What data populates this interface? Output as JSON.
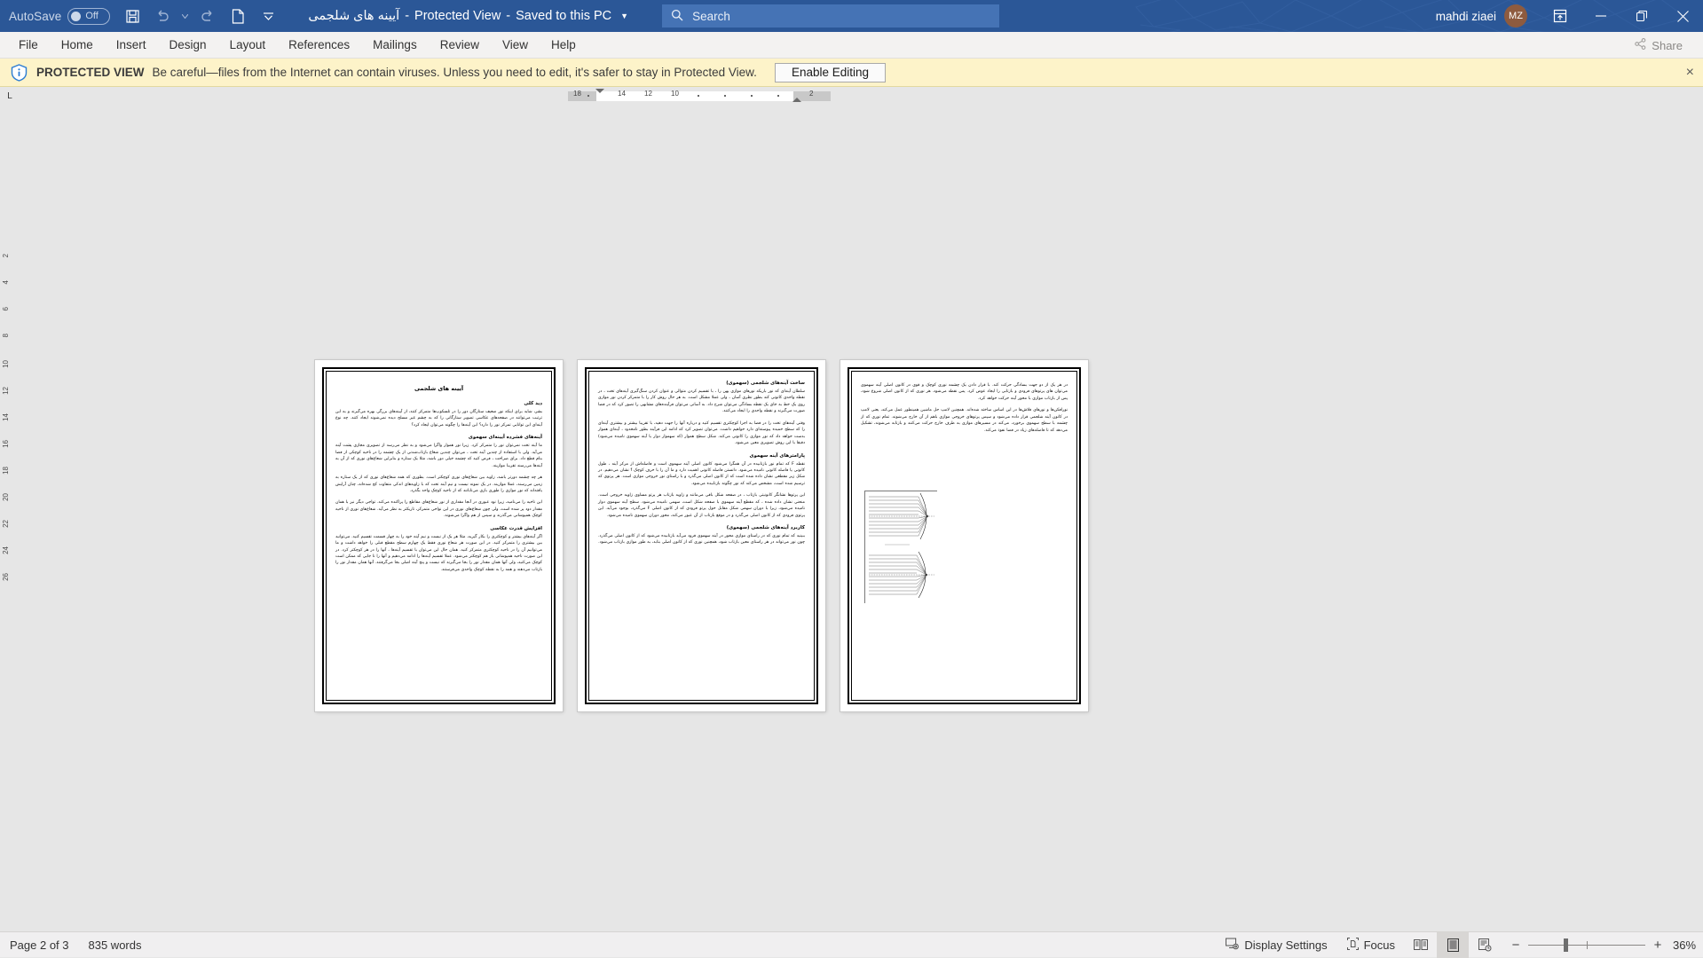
{
  "titlebar": {
    "autosave_label": "AutoSave",
    "autosave_state": "Off",
    "doc_title": "آیینه های شلجمی",
    "protected_view_label": "Protected View",
    "saved_label": "Saved to this PC",
    "search_placeholder": "Search",
    "user_name": "mahdi ziaei",
    "user_initials": "MZ",
    "accent_color": "#2b5797",
    "avatar_color": "#8e5b3f",
    "qat": [
      {
        "name": "save-icon",
        "label": "Save"
      },
      {
        "name": "undo-icon",
        "label": "Undo"
      },
      {
        "name": "redo-icon",
        "label": "Redo"
      },
      {
        "name": "new-document-icon",
        "label": "New"
      },
      {
        "name": "customize-quick-access-toolbar-icon",
        "label": "Customize Quick Access Toolbar"
      }
    ],
    "window_buttons": [
      {
        "name": "ribbon-display-options-icon",
        "label": "Ribbon Display Options"
      },
      {
        "name": "minimize-icon",
        "label": "Minimize"
      },
      {
        "name": "restore-icon",
        "label": "Restore Down"
      },
      {
        "name": "close-icon",
        "label": "Close"
      }
    ]
  },
  "ribbon": {
    "tabs": [
      {
        "label": "File"
      },
      {
        "label": "Home"
      },
      {
        "label": "Insert"
      },
      {
        "label": "Design"
      },
      {
        "label": "Layout"
      },
      {
        "label": "References"
      },
      {
        "label": "Mailings"
      },
      {
        "label": "Review"
      },
      {
        "label": "View"
      },
      {
        "label": "Help"
      }
    ],
    "share_label": "Share"
  },
  "protected_view": {
    "strong": "PROTECTED VIEW",
    "message": "Be careful—files from the Internet can contain viruses. Unless you need to edit, it's safer to stay in Protected View.",
    "enable_button": "Enable Editing",
    "close_label": "×",
    "bar_color": "#fdf3c9"
  },
  "ruler": {
    "tabstop_label": "L",
    "marks": [
      "18",
      "14",
      "12",
      "10",
      "2"
    ],
    "vertical_marks": [
      "2",
      "4",
      "6",
      "8",
      "10",
      "12",
      "14",
      "16",
      "18",
      "20",
      "22",
      "24",
      "26"
    ]
  },
  "document": {
    "title": "آیینه های شلجمی",
    "pages": [
      {
        "number": 1,
        "blocks": [
          {
            "type": "title",
            "text": "آیینه های شلجمی"
          },
          {
            "type": "heading",
            "text": "دید کلی"
          },
          {
            "type": "para",
            "text": "بشر، شاید برای اینکه نور ضعیف ستارگان دور را در تلسکوپ‌ها متمرکز کنند، از آیینه‌های بزرگی بهره می‌گیرند و به این ترتیب می‌توانند در صفحه‌های عکاسی تصویر ستارگانی را که به چشم غیر مسلح دیده نمی‌شوند ایجاد کنند. چه نوع آینه‌ای این توانایی تمرکز نور را دارد؟ این آینه‌ها را چگونه می‌توان ایجاد کرد؟"
          },
          {
            "type": "heading",
            "text": "آینه‌های فشرده آیینه‌ای سهموی"
          },
          {
            "type": "para",
            "text": "ما آینه تخت نمی‌توان نور را متمرکز کرد. زیرا نور هموار واگرا می‌شود و به نظر می‌رسد از تصویری مجازی پشت آینه می‌آید. ولی با استفاده از چندین آینه تخت ، می‌توان چندین شعاع بازتاب‌شدنی از یک چشمه را در ناحیه کوچکی از فضا بنام قطع داد. برای صراحت ، فرض کنید که چشمه خیلی دور باشد، مثلا یک ستاره و بنابراین شعاع‌های نوری که از آن به آینه‌ها می‌رسند تقریبا موازیند."
          },
          {
            "type": "para",
            "text": "هر چه چشمه دورتر باشد، زاویه بین شعاع‌های نوری کوچکتر است. بطوری که همه شعاع‌های نوری که از یک ستاره به زمین می‌رسند، عملا موازیند. در یک نمونه نیست و نیم آینه تخت که با زاویه‌های اندکی متفاوت کج شده‌اند، چنان آرایش یافته‌اند که نور موازی را طوری بازی می‌تابانند که از ناحیه کوچک واحد بگذرد."
          },
          {
            "type": "para",
            "text": "این ناحیه را می‌نامید، زیرا نود عبوری در آنجا مقداری از نور شعاع‌های مقاطع را پراکنده می‌کند. تواجی دیگر نیز با همان مقدار دود پر شده است، ولی چون شعاع‌های نوری در این نواحی متمرکز، تاریکتر به نظر می‌آید. شعاع‌های نوری از ناحیه کوچک همپوشانی می‌گذرند و سپس از هم واگرا می‌شوند."
          },
          {
            "type": "heading",
            "text": "افزایش قدرت عکاسی"
          },
          {
            "type": "para",
            "text": "اگر آینه‌های بیشتر و کوچکتری را بکار گیرید، مثلا هر یک از نیست و نیم آینه خود را به چهار قسمت تقسیم کنید. می‌توانید بین بیشتری را متمرکز کنید. در این صورت هر شعاع نوری فقط یک چهارم سطح مقطع قبلی را خواهد داشت و ما می‌توانیم آن را در ناحیه کوچکتری متمرکز کنید. همان حال این می‌توان با تقسیم آینه‌ها ، آنها را در هر کوچکتر کرد. در این صورت ناحیه همپوشانی باز هم کوچکتر می‌شود. عملا تقسیم آینه‌ها را ادامه می‌دهیم و آنها را تا جایی که ممکن است کوچک می‌کنید، ولی آنها همان مقدار نور را بجا می‌گیرند که نیست و پنج آینه اصلی بجا می‌گرفتند. آنها همان مقدار نور را بازتاب می‌دهند و همه را به نقطه کوچک واحدی می‌فرستند."
          }
        ]
      },
      {
        "number": 2,
        "blocks": [
          {
            "type": "heading",
            "text": "ساخت آینه‌های شلجمی (سهموی)"
          },
          {
            "type": "para",
            "text": "سلطان آینه‌ای که نور باریکه نورهای موازی پهن را ، با تقسیم کردن متوالی و عنوان کردن سنگ‌گیری آینه‌های تخت ، در نقطه واحدی کانونی کند بطور نظری آسان ، ولی عملا مشکل است. به هر حال روش کار را با متمرکز کردن نور موازی روی یک خط به جای یک نقطه بسادگی می‌توان شرح داد. به آسانی می‌توان فرآینده‌های مشابهی را تصور کرد که در فضا صورت می‌گیرند و نقطه واحدی را ایجاد می‌کنند."
          },
          {
            "type": "para",
            "text": "وقتی آینه‌های تخت را در فضا به اجزا کوچکتری تقسیم کنید و درباره آنها را جهت دهید، با تقریبا بیشتر و بیشتری آینه‌ای را که سطح خمیده پیوسته‌ای دارد خواهیم داشت. می‌توان تصویر کرد که ادامه این فرآیند بطور نامحدود ، آینه‌ای هموار بدست خواهد داد که نور موازی را کانونی می‌کند. شکل سطح هموار (که سهموار دوار یا آینه سهموی نامیده می‌شود) دقیقا با این روش تصویری معین می‌شود."
          },
          {
            "type": "heading",
            "text": "پارامترهای آینه سهموی"
          },
          {
            "type": "para",
            "text": "نقطه F که تمام نور بازتابیده در آن همگرا می‌شود کانون اصلی آینه سهموی است و فاصله‌اش از مرکز آینه ، طول کانونی یا فاصله کانونی نامیده می‌شود. دانستن فاصله کانونی اهمیت دارد و ما آن را با حرف کوچک f نشان می‌دهیم. در شکل زیر مقطعی نشان داده شده است که از کانون اصلی می‌گذرد و با راستای نور خروجی موازی است. هر پرتوی که ترسیم شده است، مشخص می‌کند که نور چگونه بازتابیده می‌شود."
          },
          {
            "type": "para",
            "text": "این پرتوها نشانگر کانونیتی بازتاب ، در صفحه شکل باقی می‌مانند و زاویه بازتاب هر پرتو مساوی زاویه خروجی است. منحنی نشان داده شده ، که مقطع آینه سهموی با صفحه شکل است، سهمی نامیده می‌شود. سطح آینه سهموی دوار نامیده می‌شود، زیرا با دوران سهمی شکل مقابل حول پرتو فرودی که از کانون اصلی F می‌گذرد، بوجود می‌آید. این پرتوی فرودی که از کانون اصلی می‌گذرد و در موقع بازتاب از آن عبور می‌کند، محور دوران سهموی نامیده می‌شود."
          },
          {
            "type": "heading",
            "text": "کاربرد آینه‌های شلجمی (سهموی)"
          },
          {
            "type": "para",
            "text": "ببینید که تمام نوری که در راستای موازی محور در آینه سهموی فرود می‌آید بازتابیده می‌شود که از کانون اصلی می‌گذرد. چون نور می‌تواند در هر راستای معین بازتاب شود، همچنین نوری که از کانون اصلی بتابد، به طور موازی بازتاب می‌شود."
          }
        ]
      },
      {
        "number": 3,
        "blocks": [
          {
            "type": "para",
            "text": "در هر یک از دو جهت بسادگی حرکت کند. با قرار دادن یک چشمه نوری کوچک و قوی در کانون اصلی آینه سهموی می‌توان های پرتوهای فرودی و بازتابی را ایجاد عوض کرد. پس نقطه می‌شود. هر نوری که از کانون اصلی شروع شود، پس از بازتاب موازی با محور آینه حرکت خواهد کرد."
          },
          {
            "type": "para",
            "text": "نورافکن‌ها و نورهای فلاش‌ها در این اساس ساخته شده‌اند. همچنین لامپ حل ماشین همینطور عمل می‌کند، یعنی لامپ در کانون آینه شلجمی قرار داده می‌شود و سپس پرتوهای خروجی موازی باهم از آن خارج می‌شوند. تمام نوری که از چشمه با سطح سهموی برخورد، می‌کند در مسیرهای موازی به طرف خارج حرکت می‌کنند و بازتابه می‌شوند، تشکیل می‌دهد که تا فاصله‌های زیاد در فضا نفوذ می‌کند."
          },
          {
            "type": "figure",
            "name": "parabolic-mirror-ray-diagram"
          }
        ]
      }
    ]
  },
  "statusbar": {
    "page_label": "Page 2 of 3",
    "word_count": "835 words",
    "display_settings": "Display Settings",
    "focus": "Focus",
    "view_buttons": [
      {
        "name": "read-mode-icon",
        "label": "Read Mode",
        "active": false
      },
      {
        "name": "print-layout-icon",
        "label": "Print Layout",
        "active": true
      },
      {
        "name": "web-layout-icon",
        "label": "Web Layout",
        "active": false
      }
    ],
    "zoom_out": "−",
    "zoom_in": "+",
    "zoom_level": "36%"
  }
}
